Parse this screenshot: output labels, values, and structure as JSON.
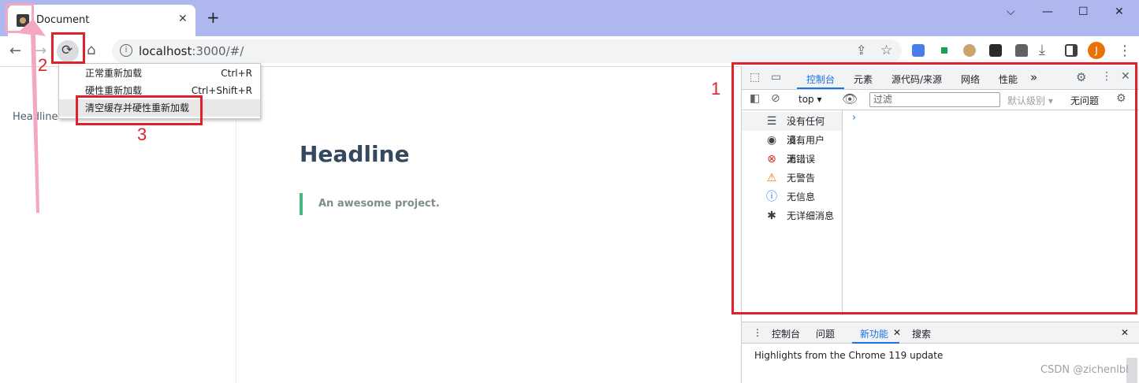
{
  "browser": {
    "tab": {
      "title": "Document",
      "close_glyph": "✕"
    },
    "new_tab_glyph": "+",
    "window_controls": {
      "dropdown": "⌵",
      "minimize": "—",
      "maximize": "☐",
      "close": "✕"
    },
    "nav": {
      "back": "←",
      "forward": "→",
      "reload": "⟳",
      "home": "⌂"
    },
    "url": {
      "host": "localhost",
      "path": ":3000/#/"
    },
    "info_glyph": "i",
    "omni_actions": {
      "share": "⇪",
      "bookmark": "☆"
    },
    "avatar_initial": "J",
    "menu_glyph": "⋮",
    "extension_icons": [
      "translate-extension-icon",
      "green-flag-extension-icon",
      "owl-extension-icon",
      "x-extension-icon",
      "puzzle-extensions-icon",
      "download-icon",
      "side-panel-icon"
    ]
  },
  "context_menu": {
    "items": [
      {
        "label": "正常重新加载",
        "shortcut": "Ctrl+R"
      },
      {
        "label": "硬性重新加载",
        "shortcut": "Ctrl+Shift+R"
      },
      {
        "label": "清空缓存并硬性重新加载",
        "shortcut": ""
      }
    ]
  },
  "page": {
    "sidebar_link": "Headline",
    "headline": "Headline",
    "quote": "An awesome project."
  },
  "devtools": {
    "tabs": [
      "控制台",
      "元素",
      "源代码/来源",
      "网络",
      "性能"
    ],
    "more_tabs": "»",
    "context_select": "top",
    "filter_placeholder": "过滤",
    "levels": "默认级别 ▾",
    "issues": "无问题",
    "sidebar": [
      {
        "icon": "list-icon",
        "glyph": "☰",
        "label": "没有任何消..."
      },
      {
        "icon": "user-icon",
        "glyph": "◉",
        "label": "没有用户消..."
      },
      {
        "icon": "error-icon",
        "glyph": "⊗",
        "label": "无错误"
      },
      {
        "icon": "warning-icon",
        "glyph": "⚠",
        "label": "无警告"
      },
      {
        "icon": "info-icon",
        "glyph": "ⓘ",
        "label": "无信息"
      },
      {
        "icon": "bug-icon",
        "glyph": "✱",
        "label": "无详细消息"
      }
    ],
    "prompt_glyph": "›",
    "drawer": {
      "tabs": [
        "控制台",
        "问题",
        "新功能",
        "搜索"
      ],
      "active_close": "✕",
      "text": "Highlights from the Chrome 119 update"
    }
  },
  "annotations": {
    "n1": "1",
    "n2": "2",
    "n3": "3"
  },
  "watermark": "CSDN @zichenlbl",
  "colors": {
    "annotation_red": "#e0202a",
    "annotation_pink": "#f4a7c0",
    "accent_blue": "#1a73e8",
    "quote_green": "#42b983"
  }
}
